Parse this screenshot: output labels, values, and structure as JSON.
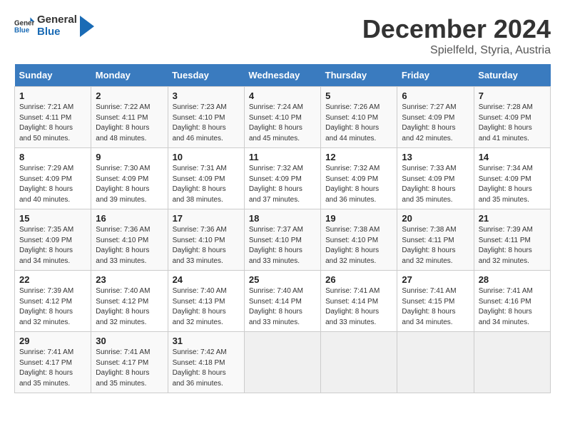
{
  "header": {
    "logo_general": "General",
    "logo_blue": "Blue",
    "title": "December 2024",
    "subtitle": "Spielfeld, Styria, Austria"
  },
  "calendar": {
    "days_of_week": [
      "Sunday",
      "Monday",
      "Tuesday",
      "Wednesday",
      "Thursday",
      "Friday",
      "Saturday"
    ],
    "weeks": [
      [
        {
          "day": "1",
          "sunrise": "Sunrise: 7:21 AM",
          "sunset": "Sunset: 4:11 PM",
          "daylight": "Daylight: 8 hours and 50 minutes."
        },
        {
          "day": "2",
          "sunrise": "Sunrise: 7:22 AM",
          "sunset": "Sunset: 4:11 PM",
          "daylight": "Daylight: 8 hours and 48 minutes."
        },
        {
          "day": "3",
          "sunrise": "Sunrise: 7:23 AM",
          "sunset": "Sunset: 4:10 PM",
          "daylight": "Daylight: 8 hours and 46 minutes."
        },
        {
          "day": "4",
          "sunrise": "Sunrise: 7:24 AM",
          "sunset": "Sunset: 4:10 PM",
          "daylight": "Daylight: 8 hours and 45 minutes."
        },
        {
          "day": "5",
          "sunrise": "Sunrise: 7:26 AM",
          "sunset": "Sunset: 4:10 PM",
          "daylight": "Daylight: 8 hours and 44 minutes."
        },
        {
          "day": "6",
          "sunrise": "Sunrise: 7:27 AM",
          "sunset": "Sunset: 4:09 PM",
          "daylight": "Daylight: 8 hours and 42 minutes."
        },
        {
          "day": "7",
          "sunrise": "Sunrise: 7:28 AM",
          "sunset": "Sunset: 4:09 PM",
          "daylight": "Daylight: 8 hours and 41 minutes."
        }
      ],
      [
        {
          "day": "8",
          "sunrise": "Sunrise: 7:29 AM",
          "sunset": "Sunset: 4:09 PM",
          "daylight": "Daylight: 8 hours and 40 minutes."
        },
        {
          "day": "9",
          "sunrise": "Sunrise: 7:30 AM",
          "sunset": "Sunset: 4:09 PM",
          "daylight": "Daylight: 8 hours and 39 minutes."
        },
        {
          "day": "10",
          "sunrise": "Sunrise: 7:31 AM",
          "sunset": "Sunset: 4:09 PM",
          "daylight": "Daylight: 8 hours and 38 minutes."
        },
        {
          "day": "11",
          "sunrise": "Sunrise: 7:32 AM",
          "sunset": "Sunset: 4:09 PM",
          "daylight": "Daylight: 8 hours and 37 minutes."
        },
        {
          "day": "12",
          "sunrise": "Sunrise: 7:32 AM",
          "sunset": "Sunset: 4:09 PM",
          "daylight": "Daylight: 8 hours and 36 minutes."
        },
        {
          "day": "13",
          "sunrise": "Sunrise: 7:33 AM",
          "sunset": "Sunset: 4:09 PM",
          "daylight": "Daylight: 8 hours and 35 minutes."
        },
        {
          "day": "14",
          "sunrise": "Sunrise: 7:34 AM",
          "sunset": "Sunset: 4:09 PM",
          "daylight": "Daylight: 8 hours and 35 minutes."
        }
      ],
      [
        {
          "day": "15",
          "sunrise": "Sunrise: 7:35 AM",
          "sunset": "Sunset: 4:09 PM",
          "daylight": "Daylight: 8 hours and 34 minutes."
        },
        {
          "day": "16",
          "sunrise": "Sunrise: 7:36 AM",
          "sunset": "Sunset: 4:10 PM",
          "daylight": "Daylight: 8 hours and 33 minutes."
        },
        {
          "day": "17",
          "sunrise": "Sunrise: 7:36 AM",
          "sunset": "Sunset: 4:10 PM",
          "daylight": "Daylight: 8 hours and 33 minutes."
        },
        {
          "day": "18",
          "sunrise": "Sunrise: 7:37 AM",
          "sunset": "Sunset: 4:10 PM",
          "daylight": "Daylight: 8 hours and 33 minutes."
        },
        {
          "day": "19",
          "sunrise": "Sunrise: 7:38 AM",
          "sunset": "Sunset: 4:10 PM",
          "daylight": "Daylight: 8 hours and 32 minutes."
        },
        {
          "day": "20",
          "sunrise": "Sunrise: 7:38 AM",
          "sunset": "Sunset: 4:11 PM",
          "daylight": "Daylight: 8 hours and 32 minutes."
        },
        {
          "day": "21",
          "sunrise": "Sunrise: 7:39 AM",
          "sunset": "Sunset: 4:11 PM",
          "daylight": "Daylight: 8 hours and 32 minutes."
        }
      ],
      [
        {
          "day": "22",
          "sunrise": "Sunrise: 7:39 AM",
          "sunset": "Sunset: 4:12 PM",
          "daylight": "Daylight: 8 hours and 32 minutes."
        },
        {
          "day": "23",
          "sunrise": "Sunrise: 7:40 AM",
          "sunset": "Sunset: 4:12 PM",
          "daylight": "Daylight: 8 hours and 32 minutes."
        },
        {
          "day": "24",
          "sunrise": "Sunrise: 7:40 AM",
          "sunset": "Sunset: 4:13 PM",
          "daylight": "Daylight: 8 hours and 32 minutes."
        },
        {
          "day": "25",
          "sunrise": "Sunrise: 7:40 AM",
          "sunset": "Sunset: 4:14 PM",
          "daylight": "Daylight: 8 hours and 33 minutes."
        },
        {
          "day": "26",
          "sunrise": "Sunrise: 7:41 AM",
          "sunset": "Sunset: 4:14 PM",
          "daylight": "Daylight: 8 hours and 33 minutes."
        },
        {
          "day": "27",
          "sunrise": "Sunrise: 7:41 AM",
          "sunset": "Sunset: 4:15 PM",
          "daylight": "Daylight: 8 hours and 34 minutes."
        },
        {
          "day": "28",
          "sunrise": "Sunrise: 7:41 AM",
          "sunset": "Sunset: 4:16 PM",
          "daylight": "Daylight: 8 hours and 34 minutes."
        }
      ],
      [
        {
          "day": "29",
          "sunrise": "Sunrise: 7:41 AM",
          "sunset": "Sunset: 4:17 PM",
          "daylight": "Daylight: 8 hours and 35 minutes."
        },
        {
          "day": "30",
          "sunrise": "Sunrise: 7:41 AM",
          "sunset": "Sunset: 4:17 PM",
          "daylight": "Daylight: 8 hours and 35 minutes."
        },
        {
          "day": "31",
          "sunrise": "Sunrise: 7:42 AM",
          "sunset": "Sunset: 4:18 PM",
          "daylight": "Daylight: 8 hours and 36 minutes."
        },
        null,
        null,
        null,
        null
      ]
    ]
  }
}
